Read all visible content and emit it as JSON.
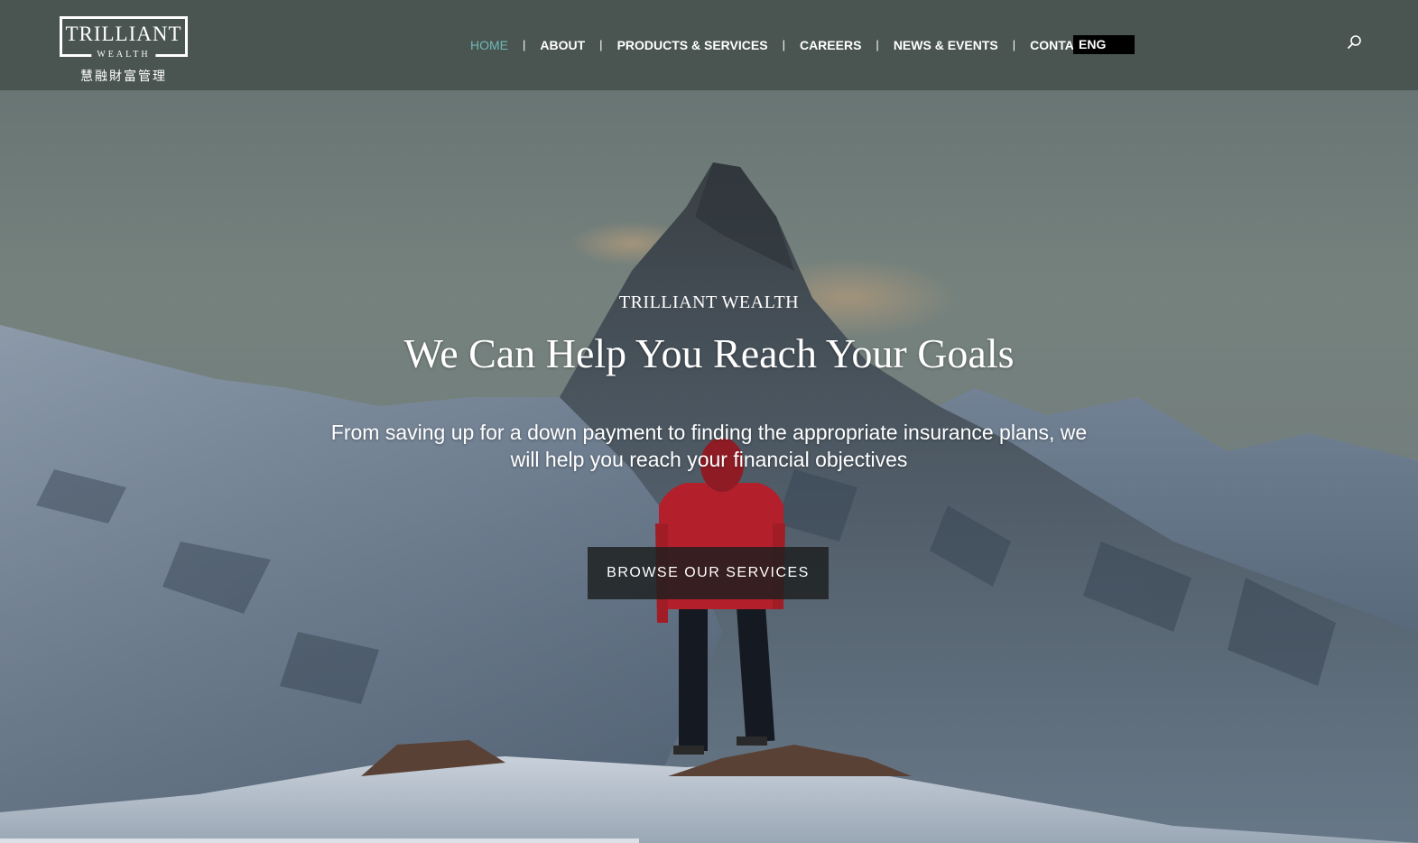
{
  "brand": {
    "logo_title": "TRILLIANT",
    "logo_sub": "WEALTH",
    "logo_cn": "慧融財富管理"
  },
  "nav": {
    "items": [
      {
        "label": "HOME",
        "active": true
      },
      {
        "label": "ABOUT",
        "active": false
      },
      {
        "label": "PRODUCTS & SERVICES",
        "active": false
      },
      {
        "label": "CAREERS",
        "active": false
      },
      {
        "label": "NEWS & EVENTS",
        "active": false
      },
      {
        "label": "CONTACT",
        "active": false
      }
    ],
    "separator": "|",
    "language": "ENG",
    "search_icon": "search-icon"
  },
  "hero": {
    "eyebrow": "TRILLIANT WEALTH",
    "title": "We Can Help You Reach Your Goals",
    "description": "From saving up for a down payment to finding the appropriate insurance plans, we will help you reach your financial objectives",
    "cta_label": "BROWSE OUR SERVICES"
  },
  "colors": {
    "header_bg": "#48524e",
    "nav_active": "#6fb7b6",
    "nav_text": "#ffffff",
    "lang_bg": "#000000",
    "cta_bg": "#1c1e1e"
  }
}
